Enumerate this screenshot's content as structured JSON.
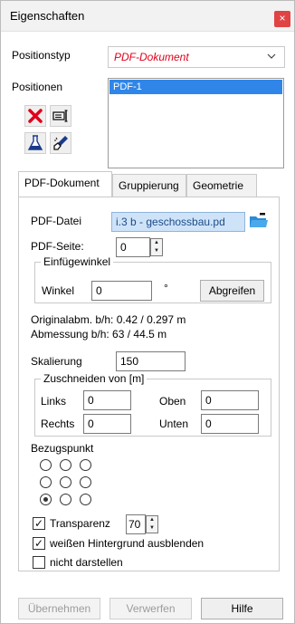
{
  "window": {
    "title": "Eigenschaften",
    "close_glyph": "×"
  },
  "position_type": {
    "label": "Positionstyp",
    "value": "PDF-Dokument"
  },
  "positions": {
    "label": "Positionen",
    "items": [
      "PDF-1"
    ]
  },
  "tabs": [
    {
      "label": "PDF-Dokument",
      "active": true
    },
    {
      "label": "Gruppierung",
      "active": false
    },
    {
      "label": "Geometrie",
      "active": false
    }
  ],
  "pdf": {
    "file_label": "PDF-Datei",
    "file_value": "i.3 b - geschossbau.pd",
    "page_label": "PDF-Seite:",
    "page_value": "0",
    "insert_angle_group": "Einfügewinkel",
    "angle_label": "Winkel",
    "angle_value": "0",
    "angle_unit": "°",
    "pick_button": "Abgreifen",
    "orig_dims": "Originalabm. b/h: 0.42 / 0.297 m",
    "dims": "Abmessung b/h: 63 / 44.5 m",
    "scale_label": "Skalierung",
    "scale_value": "150",
    "crop_group": "Zuschneiden von [m]",
    "crop_left_label": "Links",
    "crop_left_value": "0",
    "crop_top_label": "Oben",
    "crop_top_value": "0",
    "crop_right_label": "Rechts",
    "crop_right_value": "0",
    "crop_bottom_label": "Unten",
    "crop_bottom_value": "0",
    "ref_point_label": "Bezugspunkt",
    "ref_point_selected": "bottom-left",
    "transparency_label": "Transparenz",
    "transparency_checked": true,
    "transparency_value": "70",
    "hide_white_label": "weißen Hintergrund ausblenden",
    "hide_white_checked": true,
    "hide_label": "nicht darstellen",
    "hide_checked": false
  },
  "footer": {
    "apply": "Übernehmen",
    "discard": "Verwerfen",
    "help": "Hilfe"
  },
  "colors": {
    "accent_red": "#e0001a",
    "selection_blue": "#2f86e8",
    "close_red": "#e04343"
  },
  "icons": [
    "close-icon",
    "delete-icon",
    "edit-label-icon",
    "flask-icon",
    "brush-icon",
    "folder-icon",
    "chevron-down-icon"
  ]
}
